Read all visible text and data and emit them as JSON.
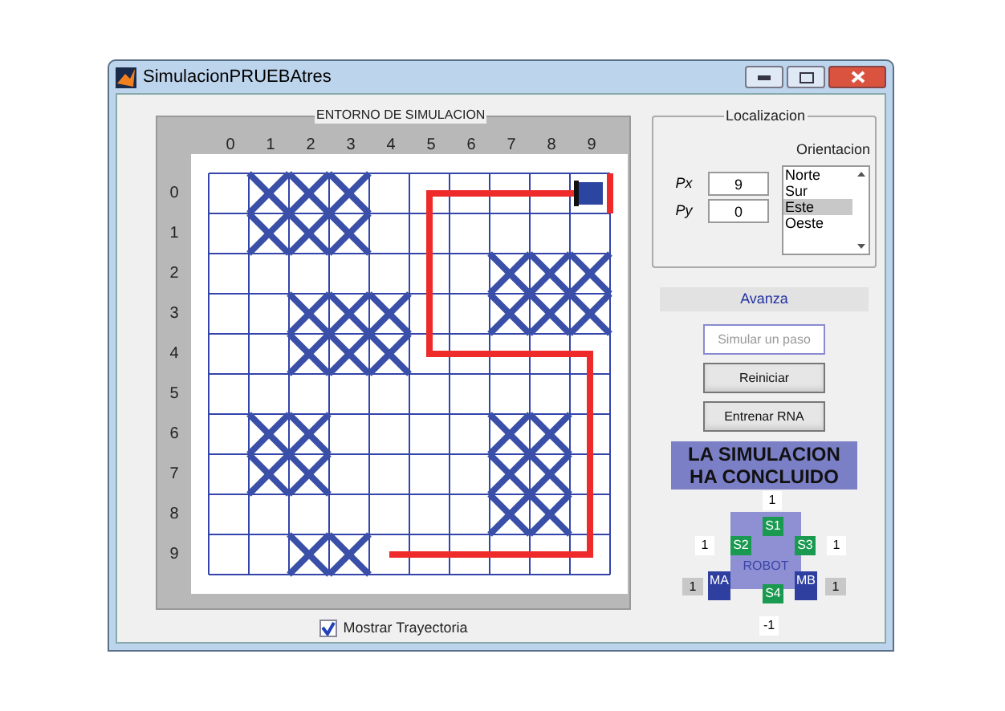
{
  "window": {
    "title": "SimulacionPRUEBAtres"
  },
  "plot": {
    "title": "ENTORNO DE SIMULACION",
    "xticks": [
      "0",
      "1",
      "2",
      "3",
      "4",
      "5",
      "6",
      "7",
      "8",
      "9"
    ],
    "yticks": [
      "0",
      "1",
      "2",
      "3",
      "4",
      "5",
      "6",
      "7",
      "8",
      "9"
    ]
  },
  "show_path": {
    "label": "Mostrar Trayectoria",
    "checked": true
  },
  "location": {
    "title": "Localizacion",
    "px": {
      "label": "Px",
      "value": "9"
    },
    "py": {
      "label": "Py",
      "value": "0"
    },
    "orientation": {
      "label": "Orientacion",
      "options": [
        {
          "label": "Norte",
          "selected": false
        },
        {
          "label": "Sur",
          "selected": false
        },
        {
          "label": "Este",
          "selected": true
        },
        {
          "label": "Oeste",
          "selected": false
        }
      ]
    }
  },
  "action": "Avanza",
  "buttons": [
    {
      "label": "Simular un paso",
      "disabled": true
    },
    {
      "label": "Reiniciar",
      "disabled": false
    },
    {
      "label": "Entrenar RNA",
      "disabled": false
    }
  ],
  "banner": [
    "LA SIMULACION",
    "HA CONCLUIDO"
  ],
  "robot": {
    "label": "ROBOT",
    "sensors": [
      {
        "label": "S1",
        "reading": "1"
      },
      {
        "label": "S2",
        "reading": "1"
      },
      {
        "label": "S3",
        "reading": "1"
      },
      {
        "label": "S4",
        "reading": "-1"
      }
    ],
    "motors": [
      {
        "label": "MA",
        "reading": "1"
      },
      {
        "label": "MB",
        "reading": "1"
      }
    ]
  }
}
